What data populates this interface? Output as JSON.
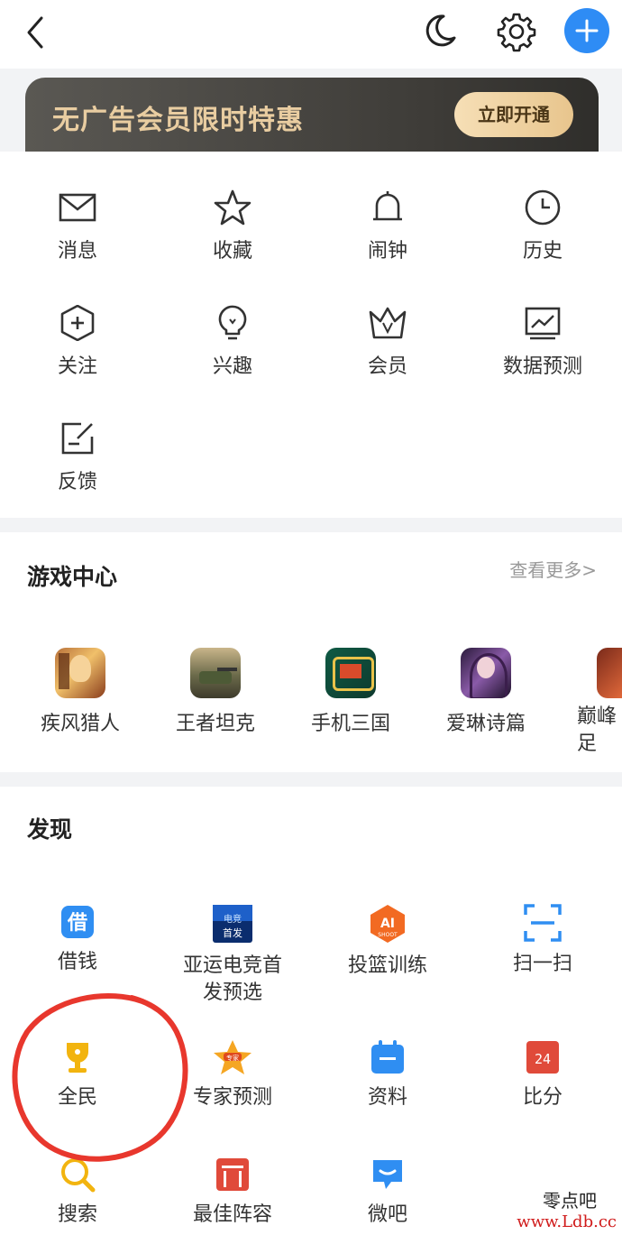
{
  "header": {
    "back_icon": "chevron-left-icon",
    "night_icon": "moon-icon",
    "settings_icon": "gear-icon",
    "add_icon": "plus-icon",
    "accent": "#2e8cf5"
  },
  "banner": {
    "title": "无广告会员限时特惠",
    "button": "立即开通"
  },
  "quick_menu": [
    {
      "label": "消息",
      "icon": "envelope-icon"
    },
    {
      "label": "收藏",
      "icon": "star-icon"
    },
    {
      "label": "闹钟",
      "icon": "bell-icon"
    },
    {
      "label": "历史",
      "icon": "clock-icon"
    },
    {
      "label": "关注",
      "icon": "hexagon-plus-icon"
    },
    {
      "label": "兴趣",
      "icon": "lightbulb-icon"
    },
    {
      "label": "会员",
      "icon": "crown-icon"
    },
    {
      "label": "数据预测",
      "icon": "chart-icon"
    },
    {
      "label": "反馈",
      "icon": "edit-icon"
    }
  ],
  "game_center": {
    "title": "游戏中心",
    "more": "查看更多>",
    "games": [
      {
        "label": "疾风猎人"
      },
      {
        "label": "王者坦克"
      },
      {
        "label": "手机三国"
      },
      {
        "label": "爱琳诗篇"
      },
      {
        "label": "巅峰足"
      }
    ]
  },
  "discover": {
    "title": "发现",
    "items": [
      {
        "label": "借钱",
        "icon": "loan-icon"
      },
      {
        "label": "亚运电竞首发预选",
        "icon": "esports-icon"
      },
      {
        "label": "投篮训练",
        "icon": "ai-shoot-icon"
      },
      {
        "label": "扫一扫",
        "icon": "scan-icon"
      },
      {
        "label": "全民",
        "icon": "trophy-icon"
      },
      {
        "label": "专家预测",
        "icon": "expert-star-icon"
      },
      {
        "label": "资料",
        "icon": "calendar-icon"
      },
      {
        "label": "比分",
        "icon": "score-icon"
      },
      {
        "label": "搜索",
        "icon": "search-icon"
      },
      {
        "label": "最佳阵容",
        "icon": "lineup-icon"
      },
      {
        "label": "微吧",
        "icon": "chat-bubble-icon"
      }
    ]
  },
  "watermark": {
    "line1": "零点吧",
    "line2": "www.Ldb.cc"
  }
}
